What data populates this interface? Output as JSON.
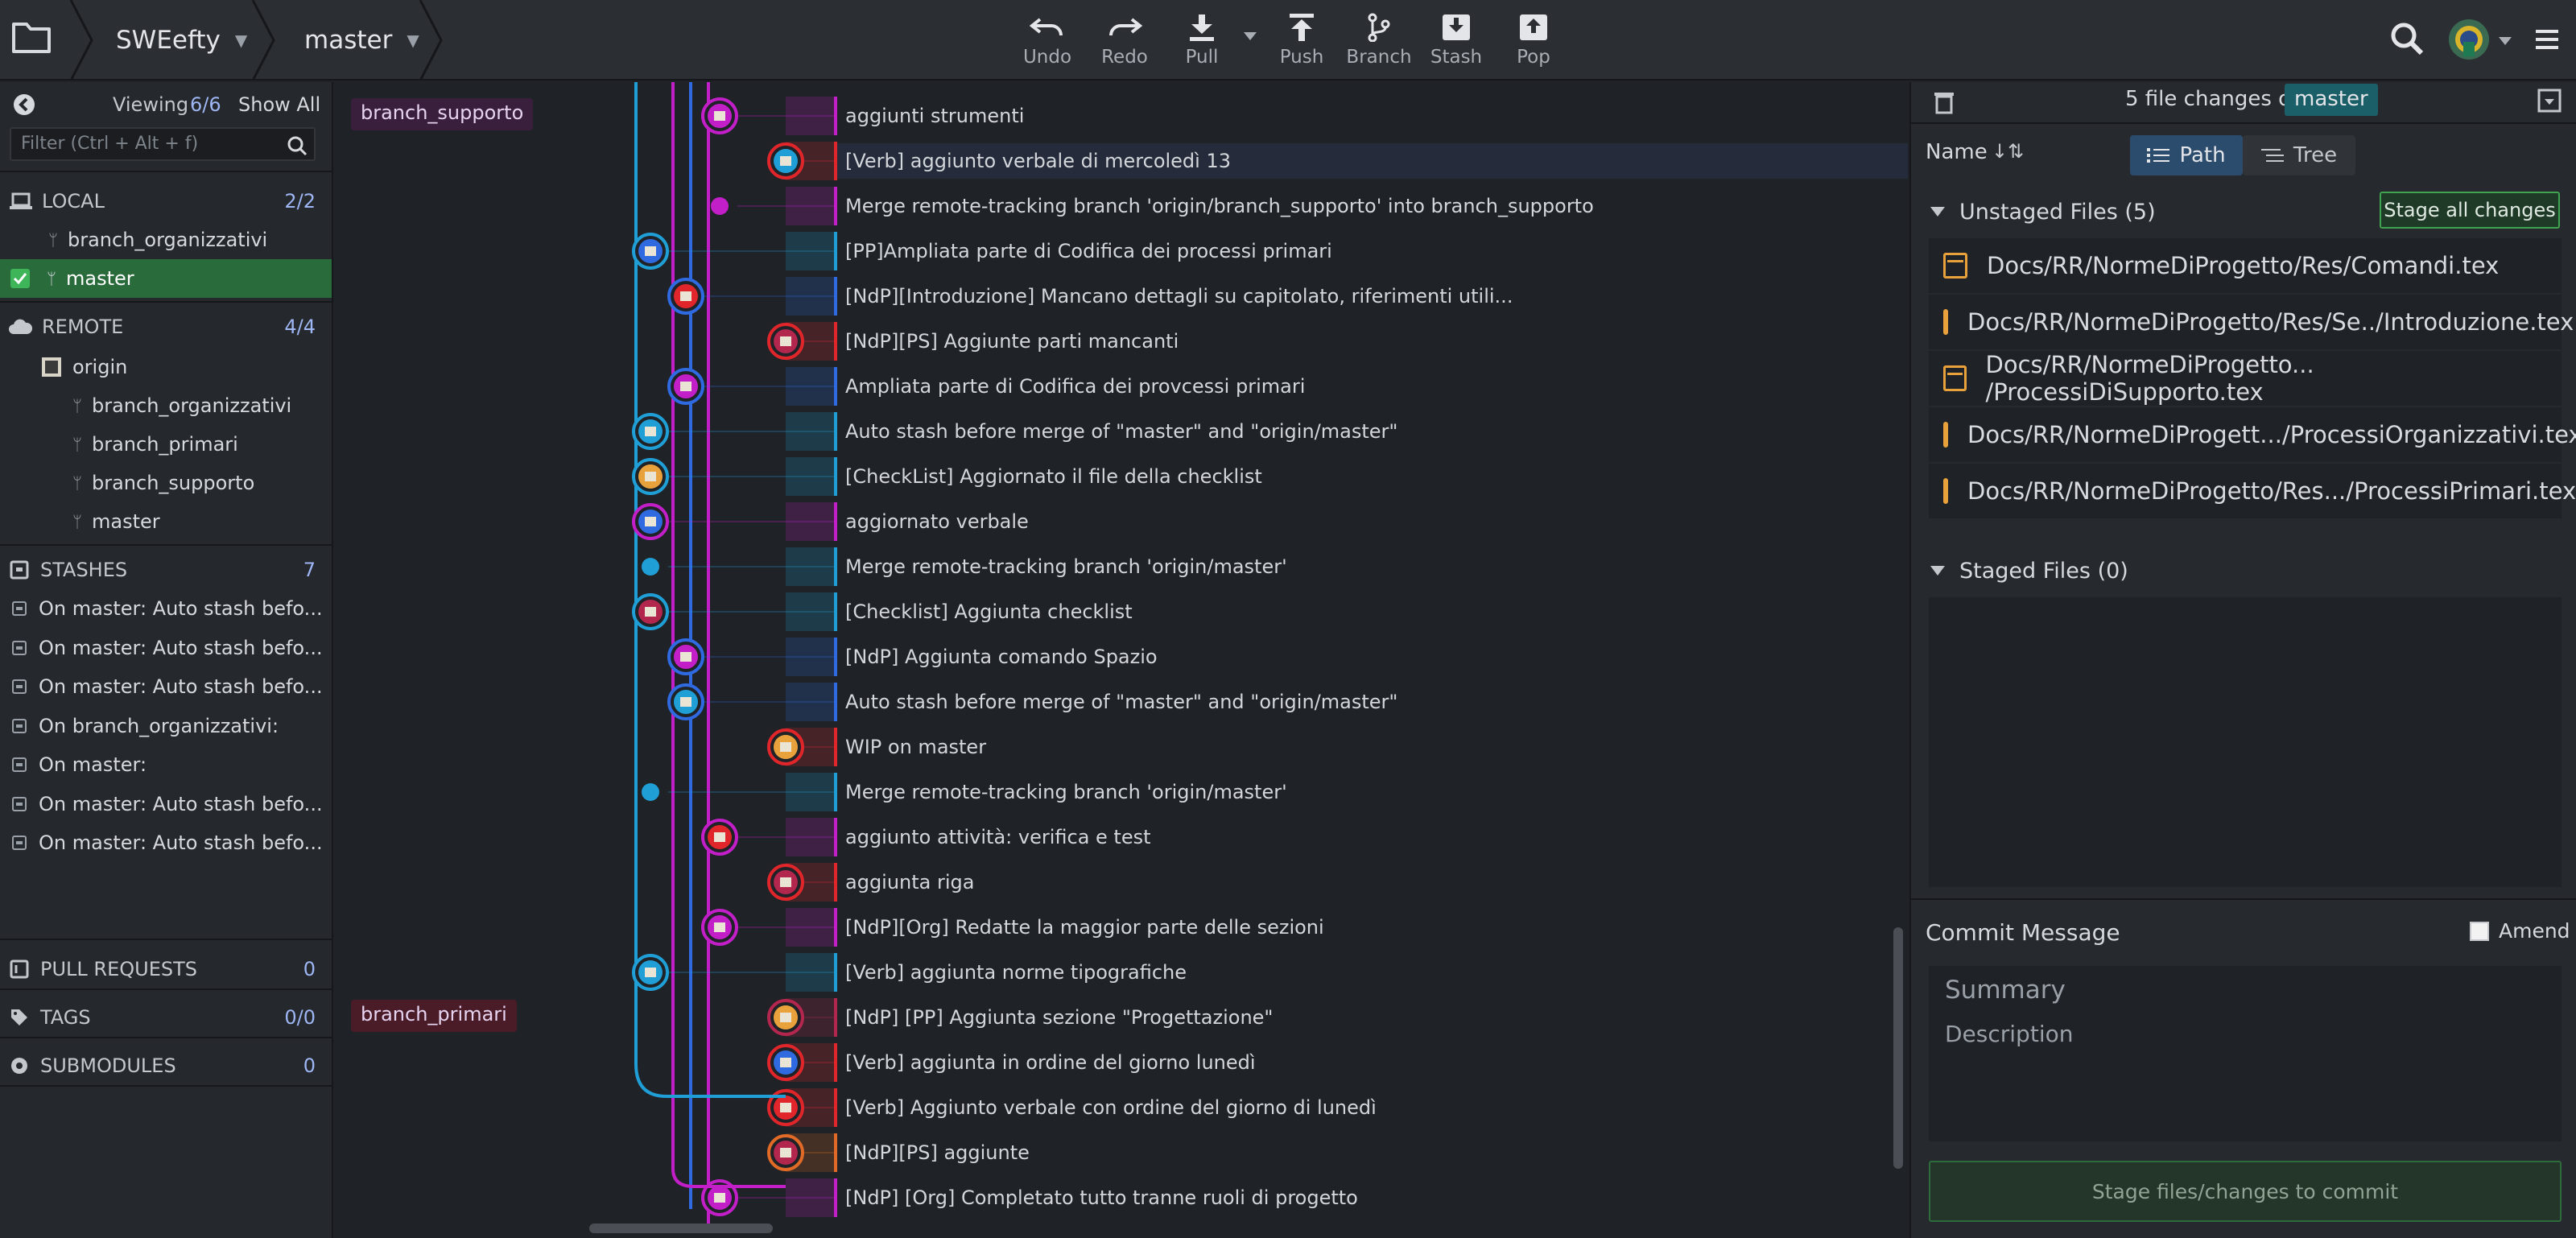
{
  "toolbar": {
    "repo_name": "SWEefty",
    "branch_name": "master",
    "buttons": [
      {
        "label": "Undo",
        "icon": "undo-icon"
      },
      {
        "label": "Redo",
        "icon": "redo-icon"
      },
      {
        "label": "Pull",
        "icon": "pull-icon"
      },
      {
        "label": "Push",
        "icon": "push-icon"
      },
      {
        "label": "Branch",
        "icon": "branch-icon"
      },
      {
        "label": "Stash",
        "icon": "stash-icon"
      },
      {
        "label": "Pop",
        "icon": "pop-icon"
      }
    ]
  },
  "leftpanel": {
    "viewing_label": "Viewing",
    "viewing_count": "6/6",
    "show_all": "Show All",
    "filter_placeholder": "Filter (Ctrl + Alt + f)",
    "local": {
      "title": "LOCAL",
      "count": "2/2",
      "branches": [
        "branch_organizzativi",
        "master"
      ]
    },
    "remote": {
      "title": "REMOTE",
      "count": "4/4",
      "origin": "origin",
      "branches": [
        "branch_organizzativi",
        "branch_primari",
        "branch_supporto",
        "master"
      ]
    },
    "stashes": {
      "title": "STASHES",
      "count": "7",
      "items": [
        "On master: Auto stash befo...",
        "On master: Auto stash befo...",
        "On master: Auto stash befo...",
        "On branch_organizzativi:",
        "On master:",
        "On master: Auto stash befo...",
        "On master: Auto stash befo..."
      ]
    },
    "pull_requests": {
      "title": "PULL REQUESTS",
      "count": "0"
    },
    "tags": {
      "title": "TAGS",
      "count": "0/0"
    },
    "submodules": {
      "title": "SUBMODULES",
      "count": "0"
    }
  },
  "graph": {
    "branch_labels": [
      "branch_supporto",
      "branch_primari"
    ],
    "commits": [
      {
        "msg": "aggiunti strumenti",
        "color": "#c21fc9"
      },
      {
        "msg": "[Verb] aggiunto verbale di mercoledì 13",
        "color": "#e0262b"
      },
      {
        "msg": "Merge remote-tracking branch 'origin/branch_supporto' into branch_supporto",
        "color": "#c21fc9"
      },
      {
        "msg": "[PP]Ampliata parte di Codifica dei processi primari",
        "color": "#1f9fd6"
      },
      {
        "msg": "[NdP][Introduzione] Mancano dettagli su capitolato, riferimenti utili...",
        "color": "#2f6ae0"
      },
      {
        "msg": "[NdP][PS] Aggiunte parti mancanti",
        "color": "#e0262b"
      },
      {
        "msg": "Ampliata parte di Codifica dei provcessi primari",
        "color": "#2f6ae0"
      },
      {
        "msg": "Auto stash before merge of \"master\" and \"origin/master\"",
        "color": "#1f9fd6"
      },
      {
        "msg": "[CheckList] Aggiornato il file della checklist",
        "color": "#1f9fd6"
      },
      {
        "msg": "aggiornato verbale",
        "color": "#c21fc9"
      },
      {
        "msg": "Merge remote-tracking branch 'origin/master'",
        "color": "#1f9fd6"
      },
      {
        "msg": "[Checklist] Aggiunta checklist",
        "color": "#1f9fd6"
      },
      {
        "msg": "[NdP] Aggiunta comando Spazio",
        "color": "#2f6ae0"
      },
      {
        "msg": "Auto stash before merge of \"master\" and \"origin/master\"",
        "color": "#2f6ae0"
      },
      {
        "msg": "WIP on master",
        "color": "#e0262b"
      },
      {
        "msg": "Merge remote-tracking branch 'origin/master'",
        "color": "#1f9fd6"
      },
      {
        "msg": "aggiunto attività: verifica e test",
        "color": "#c21fc9"
      },
      {
        "msg": "aggiunta riga",
        "color": "#e0262b"
      },
      {
        "msg": "[NdP][Org] Redatte la maggior parte delle sezioni",
        "color": "#c21fc9"
      },
      {
        "msg": "[Verb] aggiunta norme tipografiche",
        "color": "#1f9fd6"
      },
      {
        "msg": "[NdP] [PP] Aggiunta sezione \"Progettazione\"",
        "color": "#b3264d"
      },
      {
        "msg": "[Verb] aggiunta in ordine del giorno lunedì",
        "color": "#e0262b"
      },
      {
        "msg": "[Verb] Aggiunto verbale con ordine del giorno di lunedì",
        "color": "#e0262b"
      },
      {
        "msg": "[NdP][PS] aggiunte",
        "color": "#e06a26"
      },
      {
        "msg": "[NdP] [Org] Completato tutto tranne ruoli di progetto",
        "color": "#c21fc9"
      }
    ]
  },
  "rightpanel": {
    "summary_count": "5 file changes on",
    "summary_branch": "master",
    "sort_label": "Name",
    "path_label": "Path",
    "tree_label": "Tree",
    "unstaged_title": "Unstaged Files (5)",
    "stage_all": "Stage all changes",
    "files": [
      "Docs/RR/NormeDiProgetto/Res/Comandi.tex",
      "Docs/RR/NormeDiProgetto/Res/Se../Introduzione.tex",
      "Docs/RR/NormeDiProgetto... /ProcessiDiSupporto.tex",
      "Docs/RR/NormeDiProgett.../ProcessiOrganizzativi.tex",
      "Docs/RR/NormeDiProgetto/Res.../ProcessiPrimari.tex"
    ],
    "staged_title": "Staged Files (0)",
    "commit_message_title": "Commit Message",
    "amend_label": "Amend",
    "summary_placeholder": "Summary",
    "description_placeholder": "Description",
    "commit_button": "Stage files/changes to commit"
  }
}
